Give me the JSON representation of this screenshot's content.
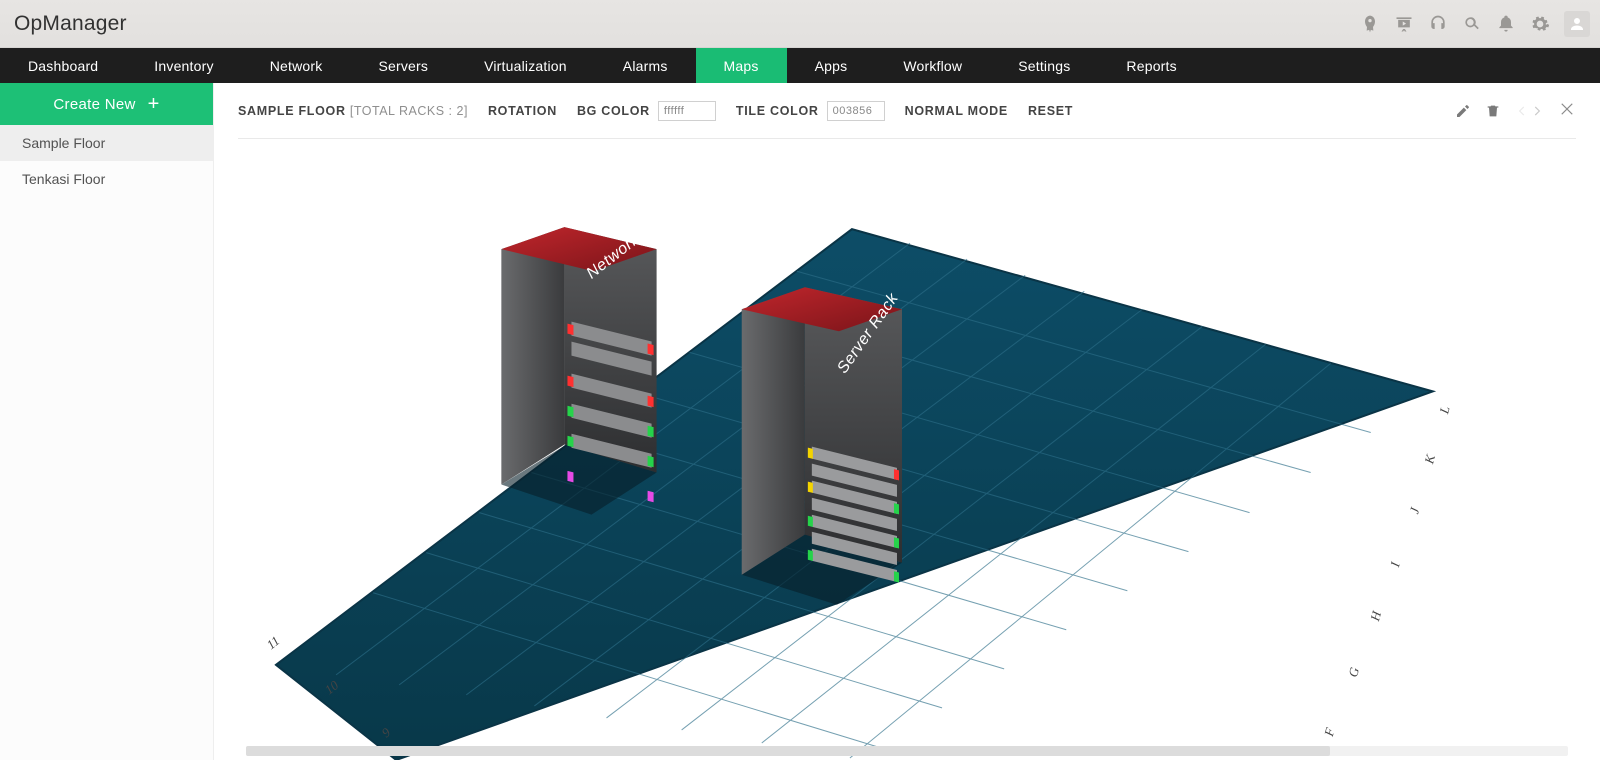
{
  "brand": "OpManager",
  "topicons": [
    "rocket",
    "presentation",
    "headset",
    "search",
    "bell",
    "gear",
    "avatar"
  ],
  "nav": {
    "items": [
      "Dashboard",
      "Inventory",
      "Network",
      "Servers",
      "Virtualization",
      "Alarms",
      "Maps",
      "Apps",
      "Workflow",
      "Settings",
      "Reports"
    ],
    "active_index": 6
  },
  "sidebar": {
    "create_label": "Create New",
    "items": [
      "Sample Floor",
      "Tenkasi Floor"
    ],
    "selected_index": 0
  },
  "toolbar": {
    "floor_name": "SAMPLE FLOOR",
    "racks_label": "[TOTAL RACKS : 2]",
    "rotation": "ROTATION",
    "bgcolor_label": "BG COLOR",
    "bgcolor_value": "ffffff",
    "tilecolor_label": "TILE COLOR",
    "tilecolor_value": "003856",
    "mode": "NORMAL MODE",
    "reset": "RESET"
  },
  "floor": {
    "row_axis_labels": [
      "11",
      "10",
      "9"
    ],
    "col_axis_labels": [
      "L",
      "K",
      "J",
      "I",
      "H",
      "G",
      "F"
    ],
    "racks": [
      {
        "name": "Network Rack"
      },
      {
        "name": "Server Rack"
      }
    ]
  },
  "colors": {
    "accent": "#1dc076",
    "tile": "#0a475f",
    "tile_line": "#2c6e88",
    "rack_top": "#a32025",
    "rack_side": "#4f5052"
  }
}
